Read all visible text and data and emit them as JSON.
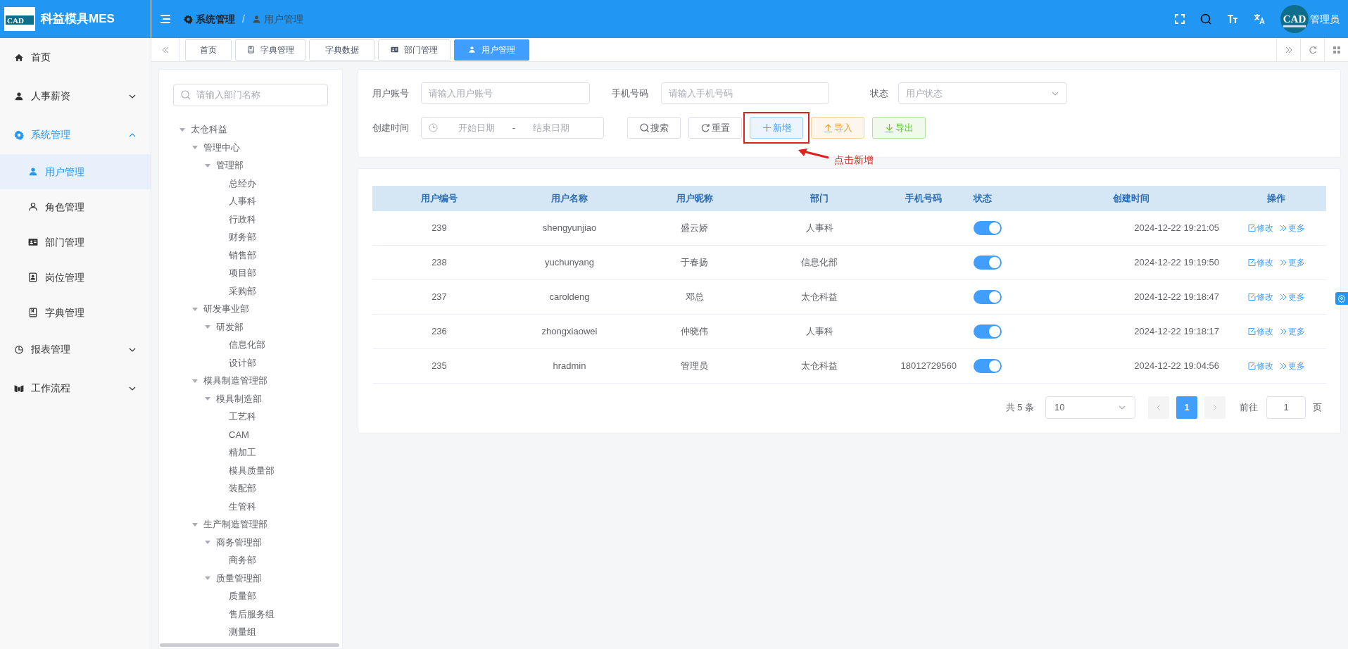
{
  "app": {
    "title": "科益模具MES",
    "logo_text": "CAD"
  },
  "header": {
    "breadcrumb": [
      "系统管理",
      "用户管理"
    ],
    "breadcrumb_separator": "/",
    "user": {
      "avatar_text": "CAD",
      "name": "管理员"
    }
  },
  "sidebar": {
    "items": [
      {
        "label": "首页",
        "selected": false
      },
      {
        "label": "人事薪资",
        "selected": false,
        "expanded": false
      },
      {
        "label": "系统管理",
        "selected": true,
        "expanded": true,
        "children": [
          {
            "label": "用户管理",
            "selected": true
          },
          {
            "label": "角色管理",
            "selected": false
          },
          {
            "label": "部门管理",
            "selected": false
          },
          {
            "label": "岗位管理",
            "selected": false
          },
          {
            "label": "字典管理",
            "selected": false
          }
        ]
      },
      {
        "label": "报表管理",
        "selected": false,
        "expanded": false
      },
      {
        "label": "工作流程",
        "selected": false,
        "expanded": false
      }
    ]
  },
  "tabs": [
    {
      "label": "首页",
      "selected": false
    },
    {
      "label": "字典管理",
      "selected": false
    },
    {
      "label": "字典数据",
      "selected": false
    },
    {
      "label": "部门管理",
      "selected": false
    },
    {
      "label": "用户管理",
      "selected": true
    }
  ],
  "dept_tree": {
    "search": {
      "placeholder": "请输入部门名称"
    },
    "nodes": [
      {
        "label": "太仓科益",
        "expanded": true,
        "children": [
          {
            "label": "管理中心",
            "expanded": true,
            "children": [
              {
                "label": "管理部",
                "expanded": true,
                "children": [
                  {
                    "label": "总经办"
                  },
                  {
                    "label": "人事科"
                  },
                  {
                    "label": "行政科"
                  },
                  {
                    "label": "财务部"
                  },
                  {
                    "label": "销售部"
                  },
                  {
                    "label": "项目部"
                  },
                  {
                    "label": "采购部"
                  }
                ]
              }
            ]
          },
          {
            "label": "研发事业部",
            "expanded": true,
            "children": [
              {
                "label": "研发部",
                "expanded": true,
                "children": [
                  {
                    "label": "信息化部"
                  },
                  {
                    "label": "设计部"
                  }
                ]
              }
            ]
          },
          {
            "label": "模具制造管理部",
            "expanded": true,
            "children": [
              {
                "label": "模具制造部",
                "expanded": true,
                "children": [
                  {
                    "label": "工艺科"
                  },
                  {
                    "label": "CAM"
                  },
                  {
                    "label": "精加工"
                  },
                  {
                    "label": "模具质量部"
                  },
                  {
                    "label": "装配部"
                  },
                  {
                    "label": "生管科"
                  }
                ]
              }
            ]
          },
          {
            "label": "生产制造管理部",
            "expanded": true,
            "children": [
              {
                "label": "商务管理部",
                "expanded": true,
                "children": [
                  {
                    "label": "商务部"
                  }
                ]
              },
              {
                "label": "质量管理部",
                "expanded": true,
                "children": [
                  {
                    "label": "质量部"
                  },
                  {
                    "label": "售后服务组"
                  },
                  {
                    "label": "测量组"
                  }
                ]
              }
            ]
          }
        ]
      }
    ]
  },
  "filters": {
    "account": {
      "label": "用户账号",
      "placeholder": "请输入用户账号"
    },
    "phone": {
      "label": "手机号码",
      "placeholder": "请输入手机号码"
    },
    "status": {
      "label": "状态",
      "placeholder": "用户状态"
    },
    "created": {
      "label": "创建时间",
      "start_placeholder": "开始日期",
      "separator": "-",
      "end_placeholder": "结束日期"
    },
    "buttons": [
      {
        "label": "搜索",
        "kind": "default"
      },
      {
        "label": "重置",
        "kind": "default"
      },
      {
        "label": "新增",
        "kind": "primary"
      },
      {
        "label": "导入",
        "kind": "warning"
      },
      {
        "label": "导出",
        "kind": "success"
      }
    ]
  },
  "annotation": {
    "text": "点击新增"
  },
  "table": {
    "columns": [
      "用户编号",
      "用户名称",
      "用户昵称",
      "部门",
      "手机号码",
      "状态",
      "创建时间",
      "操作"
    ],
    "rows": [
      {
        "id": "239",
        "username": "shengyunjiao",
        "nickname": "盛云娇",
        "dept": "人事科",
        "enabled": true,
        "created": "2024-12-22 19:21:05",
        "actions": [
          "修改",
          "更多"
        ]
      },
      {
        "id": "238",
        "username": "yuchunyang",
        "nickname": "于春扬",
        "dept": "信息化部",
        "enabled": true,
        "created": "2024-12-22 19:19:50",
        "actions": [
          "修改",
          "更多"
        ]
      },
      {
        "id": "237",
        "username": "caroldeng",
        "nickname": "邓总",
        "dept": "太仓科益",
        "enabled": true,
        "created": "2024-12-22 19:18:47",
        "actions": [
          "修改",
          "更多"
        ]
      },
      {
        "id": "236",
        "username": "zhongxiaowei",
        "nickname": "仲晓伟",
        "dept": "人事科",
        "enabled": true,
        "created": "2024-12-22 19:18:17",
        "actions": [
          "修改",
          "更多"
        ]
      },
      {
        "id": "235",
        "username": "hradmin",
        "nickname": "管理员",
        "dept": "太仓科益",
        "phone": "18012729560",
        "enabled": true,
        "created": "2024-12-22 19:04:56",
        "actions": [
          "修改",
          "更多"
        ]
      }
    ]
  },
  "pagination": {
    "total": "共 5 条",
    "page_size": "10",
    "pages": [
      {
        "label": "1",
        "selected": true
      }
    ],
    "goto_label": "前往",
    "goto_value": "1",
    "page_suffix": "页"
  }
}
